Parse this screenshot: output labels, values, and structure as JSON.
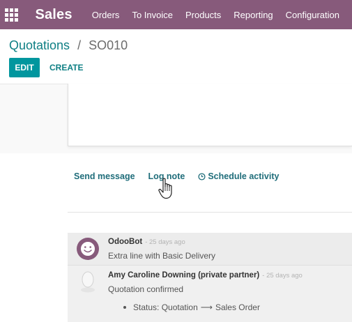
{
  "navbar": {
    "apps_icon": "apps-grid-icon",
    "brand": "Sales",
    "menu": [
      {
        "label": "Orders"
      },
      {
        "label": "To Invoice"
      },
      {
        "label": "Products"
      },
      {
        "label": "Reporting"
      },
      {
        "label": "Configuration"
      }
    ],
    "color": "#875a7b"
  },
  "breadcrumb": {
    "parent": "Quotations",
    "separator": "/",
    "current": "SO010"
  },
  "buttons": {
    "edit": "EDIT",
    "create": "CREATE"
  },
  "chatter": {
    "send_message": "Send message",
    "log_note": "Log note",
    "schedule_activity": "Schedule activity",
    "schedule_icon": "clock-icon"
  },
  "messages": [
    {
      "author": "OdooBot",
      "date": "- 25 days ago",
      "body": "Extra line with Basic Delivery",
      "avatar": "odoobot-smiley-icon"
    },
    {
      "author": "Amy Caroline Downing (private partner)",
      "date": "- 25 days ago",
      "body": "Quotation confirmed",
      "avatar": "default-user-icon",
      "tracking": {
        "field": "Status:",
        "old": "Quotation",
        "arrow": "⟶",
        "new": "Sales Order"
      }
    }
  ],
  "colors": {
    "primary": "#00a09d",
    "link": "#0e7f84"
  }
}
